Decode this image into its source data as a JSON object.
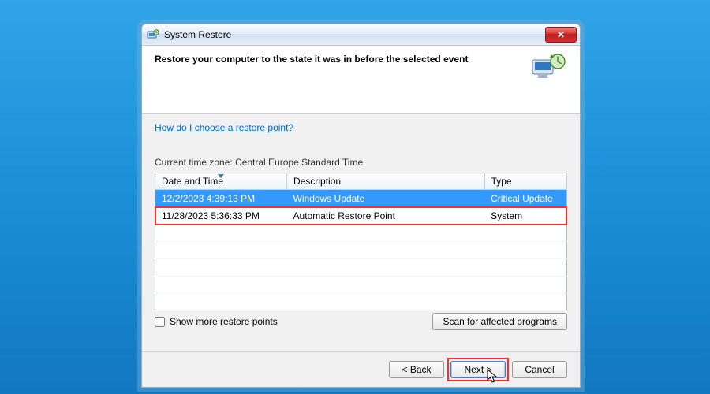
{
  "window": {
    "title": "System Restore",
    "close_glyph": "✕"
  },
  "header": {
    "heading": "Restore your computer to the state it was in before the selected event"
  },
  "help_link": "How do I choose a restore point?",
  "timezone_label": "Current time zone: Central Europe Standard Time",
  "columns": {
    "date": "Date and Time",
    "desc": "Description",
    "type": "Type"
  },
  "rows": [
    {
      "date": "12/2/2023 4:39:13 PM",
      "desc": "Windows Update",
      "type": "Critical Update"
    },
    {
      "date": "11/28/2023 5:36:33 PM",
      "desc": "Automatic Restore Point",
      "type": "System"
    }
  ],
  "show_more_label": "Show more restore points",
  "scan_button": "Scan for affected programs",
  "footer": {
    "back": "< Back",
    "next": "Next >",
    "cancel": "Cancel"
  }
}
